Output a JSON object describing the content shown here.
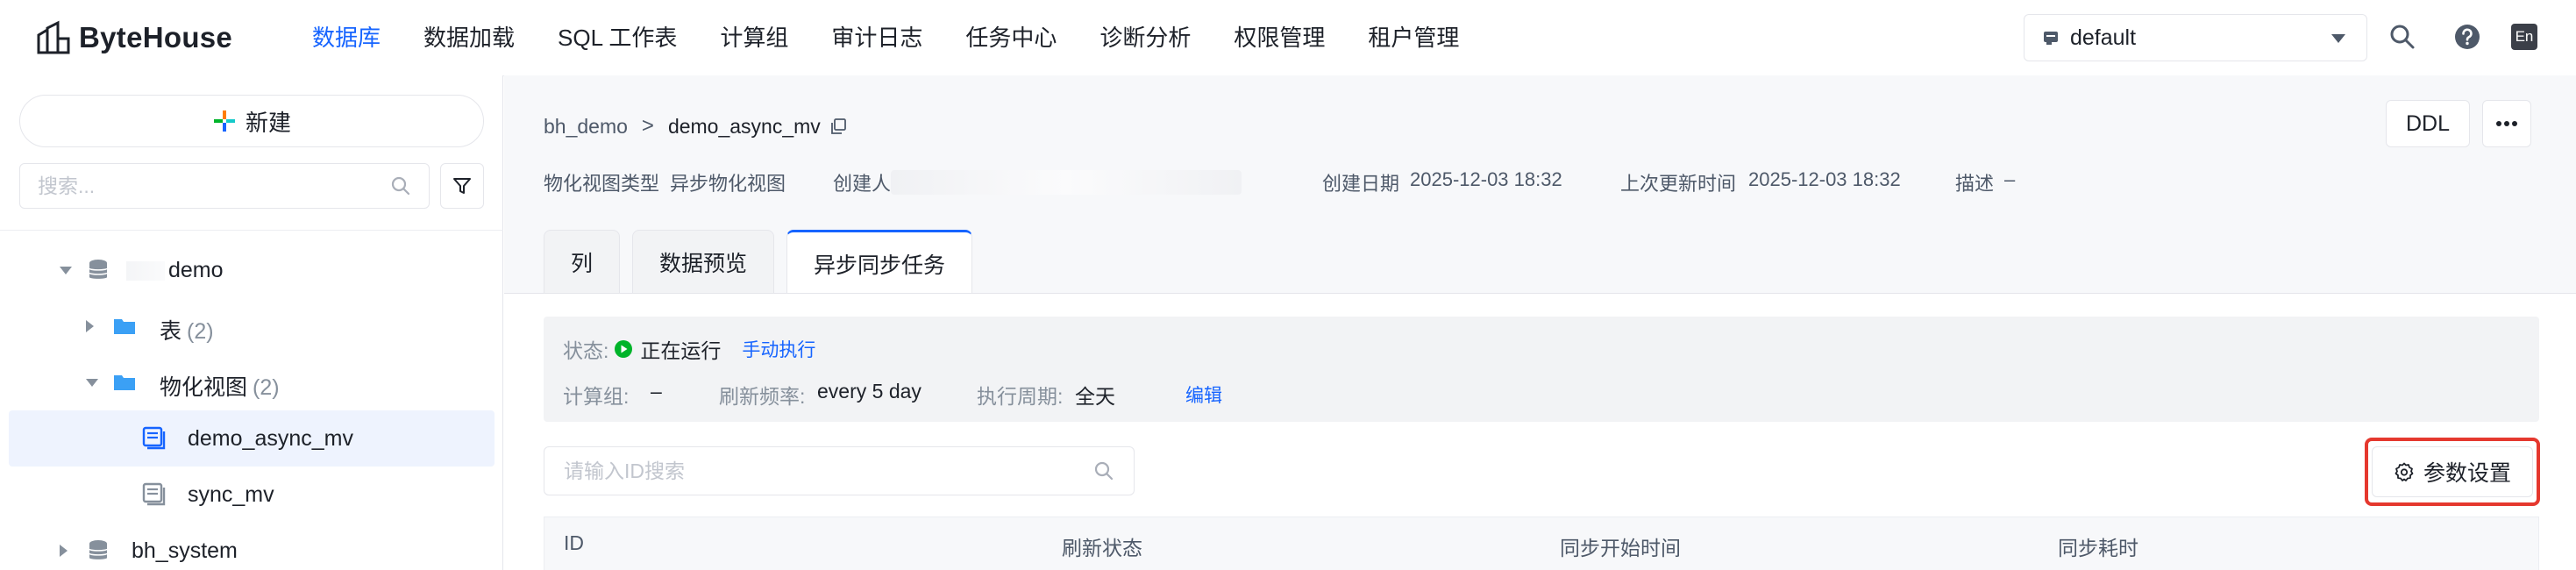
{
  "brand": {
    "name": "ByteHouse"
  },
  "nav": {
    "items": [
      "数据库",
      "数据加载",
      "SQL 工作表",
      "计算组",
      "审计日志",
      "任务中心",
      "诊断分析",
      "权限管理",
      "租户管理"
    ],
    "active_index": 0
  },
  "tenant": {
    "value": "default"
  },
  "lang": {
    "label": "En"
  },
  "sidebar": {
    "new_label": "新建",
    "search_placeholder": "搜索...",
    "tree": [
      {
        "label": "demo",
        "type": "database",
        "expanded": true
      },
      {
        "label": "表",
        "count": "(2)",
        "type": "folder",
        "expanded": false
      },
      {
        "label": "物化视图",
        "count": "(2)",
        "type": "folder",
        "expanded": true
      },
      {
        "label": "demo_async_mv",
        "type": "mv",
        "selected": true
      },
      {
        "label": "sync_mv",
        "type": "mv",
        "selected": false
      },
      {
        "label": "bh_system",
        "type": "database",
        "expanded": false
      }
    ]
  },
  "header": {
    "breadcrumb_parent": "bh_demo",
    "breadcrumb_sep": ">",
    "breadcrumb_current": "demo_async_mv",
    "ddl_label": "DDL",
    "meta": {
      "type_label": "物化视图类型",
      "type_value": "异步物化视图",
      "creator_label": "创建人",
      "created_label": "创建日期",
      "created_value": "2025-12-03 18:32",
      "updated_label": "上次更新时间",
      "updated_value": "2025-12-03 18:32",
      "desc_label": "描述",
      "desc_value": "–"
    },
    "tabs": [
      "列",
      "数据预览",
      "异步同步任务"
    ],
    "active_tab": 2
  },
  "task": {
    "status_label": "状态:",
    "status_value": "正在运行",
    "manual_run": "手动执行",
    "compute_label": "计算组:",
    "compute_value": "–",
    "refresh_label": "刷新频率:",
    "refresh_value": "every 5 day",
    "period_label": "执行周期:",
    "period_value": "全天",
    "edit_label": "编辑",
    "id_search_placeholder": "请输入ID搜索",
    "param_button": "参数设置",
    "columns": [
      "ID",
      "刷新状态",
      "同步开始时间",
      "同步耗时"
    ]
  },
  "colors": {
    "accent": "#1664ff",
    "running": "#00b42a",
    "highlight": "#e5382e"
  }
}
